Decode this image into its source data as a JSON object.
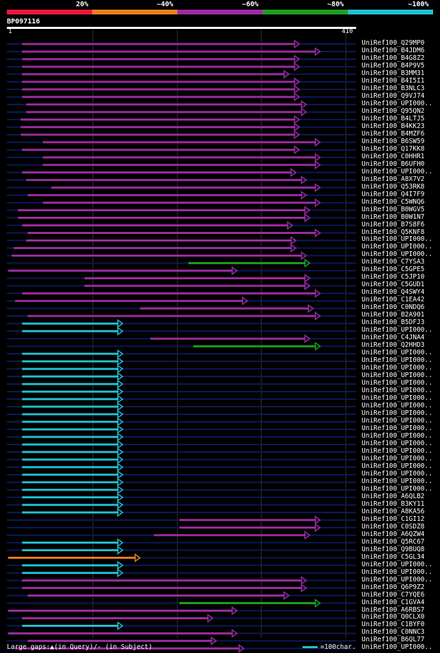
{
  "legend": {
    "segments": [
      {
        "label": "20%",
        "color": "#e8193c"
      },
      {
        "label": "~40%",
        "color": "#e9801c"
      },
      {
        "label": "~60%",
        "color": "#9b2ca0"
      },
      {
        "label": "~80%",
        "color": "#1ea01e"
      },
      {
        "label": "~100%",
        "color": "#22c0d0"
      }
    ]
  },
  "query": {
    "id": "BP097116",
    "start_label": "1",
    "end_label": "410",
    "length": 410
  },
  "footer": {
    "gaps_text": "Large gaps:▲(in Query)/- (in Subject)",
    "scale_text": "=100char."
  },
  "chart_data": {
    "type": "alignment",
    "hits": [
      {
        "name": "UniRef100_Q29MP0",
        "start": 20,
        "end": 420,
        "color": "#9b2ca0"
      },
      {
        "name": "UniRef100_B4JDM6",
        "start": 20,
        "end": 450,
        "color": "#9b2ca0"
      },
      {
        "name": "UniRef100_B4G8Z2",
        "start": 20,
        "end": 420,
        "color": "#9b2ca0"
      },
      {
        "name": "UniRef100_B4P9V5",
        "start": 20,
        "end": 420,
        "color": "#9b2ca0"
      },
      {
        "name": "UniRef100_B3MM31",
        "start": 20,
        "end": 405,
        "color": "#9b2ca0"
      },
      {
        "name": "UniRef100_B4I5I1",
        "start": 20,
        "end": 420,
        "color": "#9b2ca0"
      },
      {
        "name": "UniRef100_B3NLC3",
        "start": 20,
        "end": 420,
        "color": "#9b2ca0"
      },
      {
        "name": "UniRef100_Q9VJ74",
        "start": 20,
        "end": 420,
        "color": "#9b2ca0"
      },
      {
        "name": "UniRef100_UPI000..",
        "start": 26,
        "end": 430,
        "color": "#9b2ca0"
      },
      {
        "name": "UniRef100_Q95QN2",
        "start": 26,
        "end": 430,
        "color": "#9b2ca0"
      },
      {
        "name": "UniRef100_B4LTJ5",
        "start": 18,
        "end": 420,
        "color": "#9b2ca0"
      },
      {
        "name": "UniRef100_B4KK23",
        "start": 18,
        "end": 420,
        "color": "#9b2ca0"
      },
      {
        "name": "UniRef100_B4MZF6",
        "start": 18,
        "end": 420,
        "color": "#9b2ca0"
      },
      {
        "name": "UniRef100_B6SW59",
        "start": 50,
        "end": 450,
        "color": "#9b2ca0"
      },
      {
        "name": "UniRef100_Q17KK8",
        "start": 20,
        "end": 420,
        "color": "#9b2ca0"
      },
      {
        "name": "UniRef100_C0HHR1",
        "start": 50,
        "end": 450,
        "color": "#9b2ca0"
      },
      {
        "name": "UniRef100_B6UFH0",
        "start": 50,
        "end": 450,
        "color": "#9b2ca0"
      },
      {
        "name": "UniRef100_UPI000..",
        "start": 20,
        "end": 415,
        "color": "#9b2ca0"
      },
      {
        "name": "UniRef100_A8X7V2",
        "start": 26,
        "end": 430,
        "color": "#9b2ca0"
      },
      {
        "name": "UniRef100_Q53RK8",
        "start": 62,
        "end": 450,
        "color": "#9b2ca0"
      },
      {
        "name": "UniRef100_Q4I7F9",
        "start": 28,
        "end": 430,
        "color": "#9b2ca0"
      },
      {
        "name": "UniRef100_C5WNQ6",
        "start": 50,
        "end": 450,
        "color": "#9b2ca0"
      },
      {
        "name": "UniRef100_B0WGV5",
        "start": 14,
        "end": 435,
        "color": "#9b2ca0"
      },
      {
        "name": "UniRef100_B0W1N7",
        "start": 14,
        "end": 435,
        "color": "#9b2ca0"
      },
      {
        "name": "UniRef100_B7S8F6",
        "start": 20,
        "end": 410,
        "color": "#9b2ca0"
      },
      {
        "name": "UniRef100_Q5KNF8",
        "start": 28,
        "end": 450,
        "color": "#9b2ca0"
      },
      {
        "name": "UniRef100_UPI000..",
        "start": 26,
        "end": 415,
        "color": "#9b2ca0"
      },
      {
        "name": "UniRef100_UPI000..",
        "start": 8,
        "end": 415,
        "color": "#9b2ca0"
      },
      {
        "name": "UniRef100_UPI000..",
        "start": 5,
        "end": 430,
        "color": "#9b2ca0"
      },
      {
        "name": "UniRef100_C7YSA3",
        "start": 260,
        "end": 435,
        "color": "#1ea01e"
      },
      {
        "name": "UniRef100_C5GPE5",
        "start": 0,
        "end": 330,
        "color": "#9b2ca0"
      },
      {
        "name": "UniRef100_C5JP10",
        "start": 110,
        "end": 435,
        "color": "#9b2ca0"
      },
      {
        "name": "UniRef100_C5GUD1",
        "start": 110,
        "end": 435,
        "color": "#9b2ca0"
      },
      {
        "name": "UniRef100_Q4SWY4",
        "start": 20,
        "end": 450,
        "color": "#9b2ca0"
      },
      {
        "name": "UniRef100_C1EA42",
        "start": 10,
        "end": 345,
        "color": "#9b2ca0"
      },
      {
        "name": "UniRef100_C0NDQ6",
        "start": 190,
        "end": 440,
        "color": "#9b2ca0"
      },
      {
        "name": "UniRef100_B2A901",
        "start": 28,
        "end": 450,
        "color": "#9b2ca0"
      },
      {
        "name": "UniRef100_B5DFJ3",
        "start": 20,
        "end": 165,
        "color": "#22c0d0"
      },
      {
        "name": "UniRef100_UPI000..",
        "start": 20,
        "end": 165,
        "color": "#22c0d0"
      },
      {
        "name": "UniRef100_C4JNA4",
        "start": 205,
        "end": 435,
        "color": "#9b2ca0"
      },
      {
        "name": "UniRef100_Q2HHD3",
        "start": 267,
        "end": 450,
        "color": "#1ea01e"
      },
      {
        "name": "UniRef100_UPI000..",
        "start": 20,
        "end": 165,
        "color": "#22c0d0"
      },
      {
        "name": "UniRef100_UPI000..",
        "start": 20,
        "end": 165,
        "color": "#22c0d0"
      },
      {
        "name": "UniRef100_UPI000..",
        "start": 20,
        "end": 165,
        "color": "#22c0d0"
      },
      {
        "name": "UniRef100_UPI000..",
        "start": 20,
        "end": 165,
        "color": "#22c0d0"
      },
      {
        "name": "UniRef100_UPI000..",
        "start": 20,
        "end": 165,
        "color": "#22c0d0"
      },
      {
        "name": "UniRef100_UPI000..",
        "start": 20,
        "end": 165,
        "color": "#22c0d0"
      },
      {
        "name": "UniRef100_UPI000..",
        "start": 20,
        "end": 165,
        "color": "#22c0d0"
      },
      {
        "name": "UniRef100_UPI000..",
        "start": 20,
        "end": 165,
        "color": "#22c0d0"
      },
      {
        "name": "UniRef100_UPI000..",
        "start": 20,
        "end": 165,
        "color": "#22c0d0"
      },
      {
        "name": "UniRef100_UPI000..",
        "start": 20,
        "end": 165,
        "color": "#22c0d0"
      },
      {
        "name": "UniRef100_UPI000..",
        "start": 20,
        "end": 165,
        "color": "#22c0d0"
      },
      {
        "name": "UniRef100_UPI000..",
        "start": 20,
        "end": 165,
        "color": "#22c0d0"
      },
      {
        "name": "UniRef100_UPI000..",
        "start": 20,
        "end": 165,
        "color": "#22c0d0"
      },
      {
        "name": "UniRef100_UPI000..",
        "start": 20,
        "end": 165,
        "color": "#22c0d0"
      },
      {
        "name": "UniRef100_UPI000..",
        "start": 20,
        "end": 165,
        "color": "#22c0d0"
      },
      {
        "name": "UniRef100_UPI000..",
        "start": 20,
        "end": 165,
        "color": "#22c0d0"
      },
      {
        "name": "UniRef100_UPI000..",
        "start": 20,
        "end": 165,
        "color": "#22c0d0"
      },
      {
        "name": "UniRef100_UPI000..",
        "start": 20,
        "end": 165,
        "color": "#22c0d0"
      },
      {
        "name": "UniRef100_UPI000..",
        "start": 20,
        "end": 165,
        "color": "#22c0d0"
      },
      {
        "name": "UniRef100_A6QLB2",
        "start": 20,
        "end": 165,
        "color": "#22c0d0"
      },
      {
        "name": "UniRef100_B3KY11",
        "start": 20,
        "end": 165,
        "color": "#22c0d0"
      },
      {
        "name": "UniRef100_A8KA56",
        "start": 20,
        "end": 165,
        "color": "#22c0d0"
      },
      {
        "name": "UniRef100_C1GI12",
        "start": 247,
        "end": 450,
        "color": "#9b2ca0"
      },
      {
        "name": "UniRef100_C0SDZ8",
        "start": 247,
        "end": 450,
        "color": "#9b2ca0"
      },
      {
        "name": "UniRef100_A6QZW4",
        "start": 210,
        "end": 435,
        "color": "#9b2ca0"
      },
      {
        "name": "UniRef100_Q5RC67",
        "start": 20,
        "end": 165,
        "color": "#22c0d0"
      },
      {
        "name": "UniRef100_Q9BUQ8",
        "start": 20,
        "end": 165,
        "color": "#22c0d0"
      },
      {
        "name": "UniRef100_C5GL34",
        "start": 0,
        "end": 190,
        "color": "#e9801c"
      },
      {
        "name": "UniRef100_UPI000..",
        "start": 20,
        "end": 165,
        "color": "#22c0d0"
      },
      {
        "name": "UniRef100_UPI000..",
        "start": 20,
        "end": 165,
        "color": "#22c0d0"
      },
      {
        "name": "UniRef100_UPI000..",
        "start": 20,
        "end": 430,
        "color": "#9b2ca0"
      },
      {
        "name": "UniRef100_Q6P9Z2",
        "start": 20,
        "end": 430,
        "color": "#9b2ca0"
      },
      {
        "name": "UniRef100_C7YQE6",
        "start": 28,
        "end": 405,
        "color": "#9b2ca0"
      },
      {
        "name": "UniRef100_C1GVA4",
        "start": 247,
        "end": 450,
        "color": "#1ea01e"
      },
      {
        "name": "UniRef100_A6RBS7",
        "start": 0,
        "end": 330,
        "color": "#9b2ca0"
      },
      {
        "name": "UniRef100_Q0CLX0",
        "start": 20,
        "end": 295,
        "color": "#9b2ca0"
      },
      {
        "name": "UniRef100_C1BYF0",
        "start": 20,
        "end": 165,
        "color": "#22c0d0"
      },
      {
        "name": "UniRef100_C0NNC3",
        "start": 0,
        "end": 330,
        "color": "#9b2ca0"
      },
      {
        "name": "UniRef100_B6QL77",
        "start": 28,
        "end": 300,
        "color": "#9b2ca0"
      },
      {
        "name": "UniRef100_UPI000..",
        "start": 10,
        "end": 340,
        "color": "#9b2ca0"
      }
    ]
  }
}
